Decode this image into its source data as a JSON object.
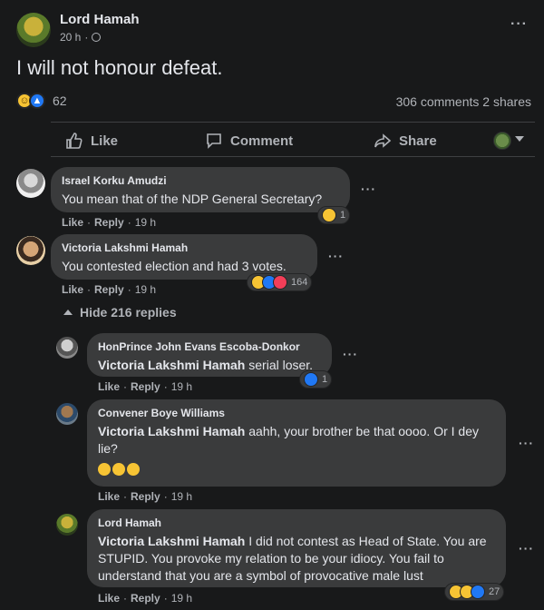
{
  "post": {
    "author": "Lord Hamah",
    "time": "20 h",
    "separator": "·",
    "more": "···",
    "text": "I will not honour defeat.",
    "reaction_count": "62",
    "comments": "306 comments",
    "shares": "2 shares"
  },
  "actions": {
    "like": "Like",
    "comment": "Comment",
    "share": "Share"
  },
  "comments": [
    {
      "author": "Israel Korku Amudzi",
      "text": "You mean that of the NDP General Secretary?",
      "like": "Like",
      "reply": "Reply",
      "time": "19 h",
      "reactions": "1"
    },
    {
      "author": "Victoria Lakshmi Hamah",
      "text": "You contested election and had 3 votes.",
      "like": "Like",
      "reply": "Reply",
      "time": "19 h",
      "reactions": "164"
    }
  ],
  "hide_replies": "Hide 216 replies",
  "replies": [
    {
      "author": "HonPrince John Evans Escoba-Donkor",
      "mention": "Victoria Lakshmi Hamah",
      "text": " serial loser.",
      "like": "Like",
      "reply": "Reply",
      "time": "19 h",
      "reactions": "1"
    },
    {
      "author": "Convener Boye Williams",
      "mention": "Victoria Lakshmi Hamah",
      "text": " aahh, your brother be that oooo. Or I dey lie?",
      "like": "Like",
      "reply": "Reply",
      "time": "19 h"
    },
    {
      "author": "Lord Hamah",
      "mention": "Victoria Lakshmi Hamah",
      "text": " I did not contest as Head of State. You are STUPID. You provoke my relation to be your idiocy. You fail to understand that you are a symbol of provocative male lust",
      "like": "Like",
      "reply": "Reply",
      "time": "19 h",
      "reactions": "27"
    }
  ],
  "colors": {
    "background": "#18191a",
    "bubble": "#3a3b3c",
    "text": "#e4e6eb",
    "muted": "#b0b3b8",
    "like_blue": "#2078f4",
    "haha_yellow": "#f7c434",
    "love_red": "#f33e58"
  },
  "icons": [
    "globe-icon",
    "more-icon",
    "haha-icon",
    "like-icon",
    "love-icon",
    "thumbs-up-icon",
    "comment-icon",
    "share-icon",
    "chevron-down-icon",
    "chevron-up-icon"
  ]
}
